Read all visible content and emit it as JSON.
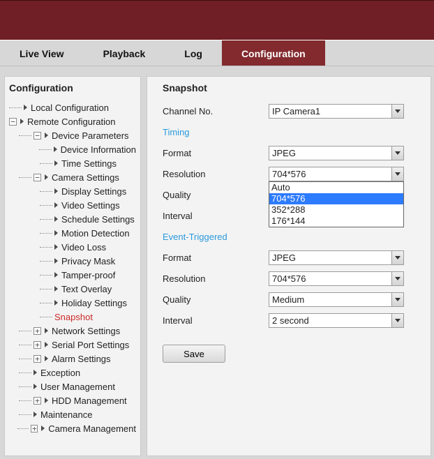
{
  "tabs": {
    "live_view": "Live View",
    "playback": "Playback",
    "log": "Log",
    "configuration": "Configuration"
  },
  "sidebar": {
    "title": "Configuration",
    "local_configuration": "Local Configuration",
    "remote_configuration": "Remote Configuration",
    "device_parameters": "Device Parameters",
    "device_information": "Device Information",
    "time_settings": "Time Settings",
    "camera_settings": "Camera Settings",
    "display_settings": "Display Settings",
    "video_settings": "Video Settings",
    "schedule_settings": "Schedule Settings",
    "motion_detection": "Motion Detection",
    "video_loss": "Video Loss",
    "privacy_mask": "Privacy Mask",
    "tamper_proof": "Tamper-proof",
    "text_overlay": "Text Overlay",
    "holiday_settings": "Holiday Settings",
    "snapshot": "Snapshot",
    "network_settings": "Network Settings",
    "serial_port_settings": "Serial Port Settings",
    "alarm_settings": "Alarm Settings",
    "exception": "Exception",
    "user_management": "User Management",
    "hdd_management": "HDD Management",
    "maintenance": "Maintenance",
    "camera_management": "Camera Management"
  },
  "main": {
    "title": "Snapshot",
    "channel_no_label": "Channel No.",
    "channel_no_value": "IP Camera1",
    "timing_header": "Timing",
    "event_header": "Event-Triggered",
    "format_label": "Format",
    "resolution_label": "Resolution",
    "quality_label": "Quality",
    "interval_label": "Interval",
    "timing_format_value": "JPEG",
    "timing_resolution_value": "704*576",
    "timing_resolution_options": {
      "o0": "Auto",
      "o1": "704*576",
      "o2": "352*288",
      "o3": "176*144"
    },
    "event_format_value": "JPEG",
    "event_resolution_value": "704*576",
    "event_quality_value": "Medium",
    "event_interval_value": "2 second",
    "save_label": "Save"
  }
}
